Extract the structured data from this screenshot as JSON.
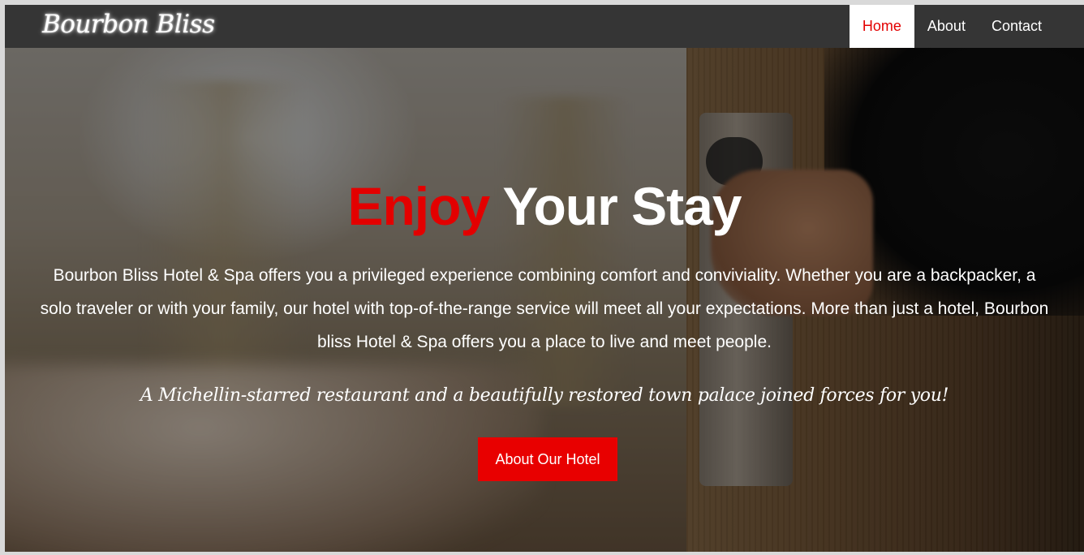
{
  "brand": {
    "name": "Bourbon Bliss"
  },
  "nav": {
    "items": [
      {
        "label": "Home",
        "active": true
      },
      {
        "label": "About",
        "active": false
      },
      {
        "label": "Contact",
        "active": false
      }
    ]
  },
  "hero": {
    "title_accent": "Enjoy",
    "title_rest": "Your Stay",
    "description": "Bourbon Bliss Hotel & Spa offers you a privileged experience combining comfort and conviviality. Whether you are a backpacker, a solo traveler or with your family, our hotel with top-of-the-range service will meet all your expectations. More than just a hotel, Bourbon bliss Hotel & Spa offers you a place to live and meet people.",
    "tagline": "A Michellin-starred restaurant and a beautifully restored town palace joined forces for you!",
    "button_label": "About Our Hotel",
    "background_image": "hotel-door-keycard-photo"
  },
  "colors": {
    "accent": "#e30000",
    "navbar": "#353535",
    "button": "#e80000",
    "text": "#ffffff"
  }
}
